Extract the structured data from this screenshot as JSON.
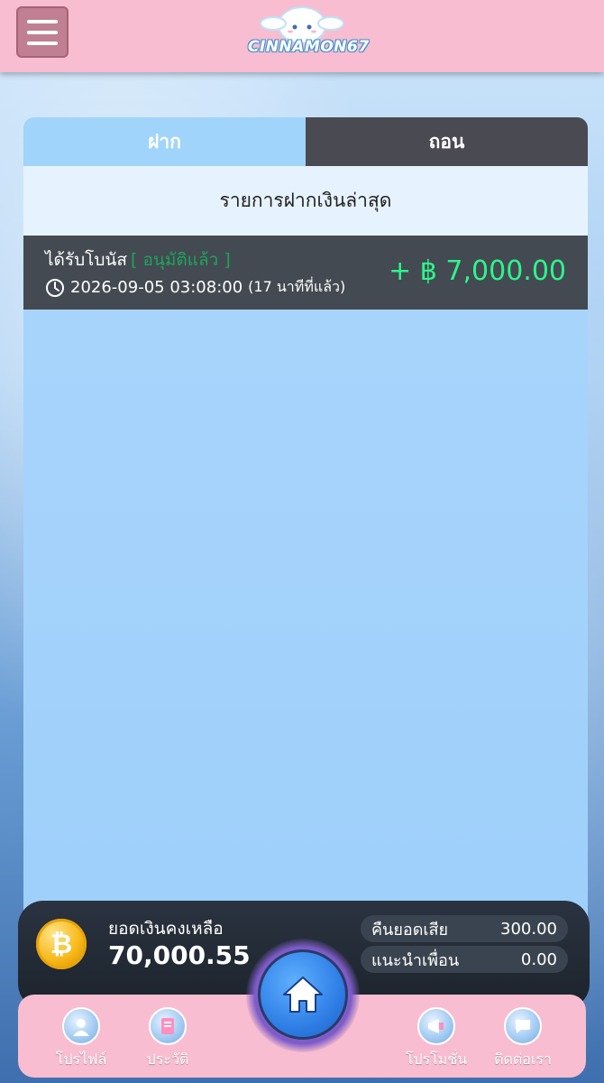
{
  "header": {
    "logo_text": "CINNAMON67"
  },
  "tabs": [
    {
      "label": "ฝาก",
      "active": true
    },
    {
      "label": "ถอน",
      "active": false
    }
  ],
  "subtitle": "รายการฝากเงินล่าสุด",
  "transaction": {
    "title": "ได้รับโบนัส",
    "status": "[ อนุมัติแล้ว ]",
    "datetime": "2026-09-05 03:08:00",
    "ago": "(17 นาทีที่แล้ว)",
    "amount": "+ ฿ 7,000.00"
  },
  "balance": {
    "label": "ยอดเงินคงเหลือ",
    "value": "70,000.55",
    "coin_symbol": "₿",
    "stats": [
      {
        "label": "คืนยอดเสีย",
        "value": "300.00"
      },
      {
        "label": "แนะนำเพื่อน",
        "value": "0.00"
      }
    ]
  },
  "nav": [
    {
      "label": "โปรไฟล์",
      "icon": "profile-icon"
    },
    {
      "label": "ประวัติ",
      "icon": "history-icon"
    },
    {
      "label": "โปรโมชั่น",
      "icon": "promotion-icon"
    },
    {
      "label": "ติดต่อเรา",
      "icon": "contact-icon"
    }
  ],
  "colors": {
    "header_bg": "#f8bdd0",
    "tab_active": "#a0d4fb",
    "tab_inactive": "#4a4a52",
    "amount_green": "#2ef58a",
    "status_green": "#1fa35a"
  }
}
